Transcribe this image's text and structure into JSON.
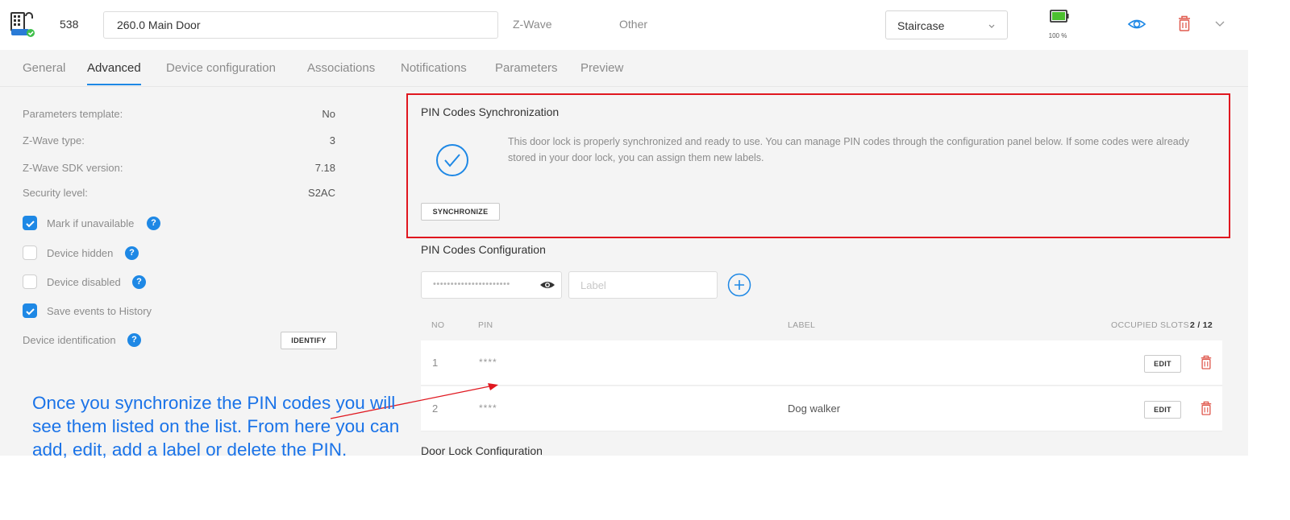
{
  "header": {
    "device_id": "538",
    "device_name": "260.0 Main Door",
    "protocol": "Z-Wave",
    "category": "Other",
    "room": "Staircase",
    "battery_percent": 100,
    "battery_label": "100 %",
    "icons": {
      "device": "door-lock-device-icon",
      "eye": "eye-icon",
      "trash": "trash-icon",
      "expand": "chevron-down-icon"
    }
  },
  "tabs": [
    {
      "label": "General",
      "active": false
    },
    {
      "label": "Advanced",
      "active": true
    },
    {
      "label": "Device configuration",
      "active": false
    },
    {
      "label": "Associations",
      "active": false
    },
    {
      "label": "Notifications",
      "active": false
    },
    {
      "label": "Parameters",
      "active": false
    },
    {
      "label": "Preview",
      "active": false
    }
  ],
  "properties": [
    {
      "label": "Parameters template:",
      "value": "No"
    },
    {
      "label": "Z-Wave type:",
      "value": "3"
    },
    {
      "label": "Z-Wave SDK version:",
      "value": "7.18"
    },
    {
      "label": "Security level:",
      "value": "S2AC"
    }
  ],
  "checkboxes": [
    {
      "label": "Mark if unavailable",
      "checked": true,
      "help": true
    },
    {
      "label": "Device hidden",
      "checked": false,
      "help": true
    },
    {
      "label": "Device disabled",
      "checked": false,
      "help": true
    },
    {
      "label": "Save events to History",
      "checked": true,
      "help": false
    }
  ],
  "identification": {
    "label": "Device identification",
    "button": "IDENTIFY"
  },
  "sync": {
    "title": "PIN Codes Synchronization",
    "message": "This door lock is properly synchronized and ready to use. You can manage PIN codes through the configuration panel below. If some codes were already stored in your door lock, you can assign them new labels.",
    "button": "SYNCHRONIZE"
  },
  "config": {
    "title": "PIN Codes Configuration",
    "pin_placeholder": "••••••••••••••••••••••",
    "label_placeholder": "Label",
    "columns": {
      "no": "NO",
      "pin": "PIN",
      "label": "LABEL",
      "occupied_prefix": "OCCUPIED SLOTS:",
      "occupied_value": "2 / 12"
    },
    "rows": [
      {
        "no": "1",
        "pin": "****",
        "label": "",
        "edit": "EDIT"
      },
      {
        "no": "2",
        "pin": "****",
        "label": "Dog walker",
        "edit": "EDIT"
      }
    ]
  },
  "next_section_title": "Door Lock Configuration",
  "annotation": "Once you synchronize the PIN codes you will see them listed on the list. From here you can add, edit, add a label or delete the PIN.",
  "colors": {
    "accent": "#1e88e5",
    "highlight_box": "#e0171f",
    "annotation": "#1a73e8",
    "delete": "#e05a4f",
    "battery": "#4cc02f"
  }
}
